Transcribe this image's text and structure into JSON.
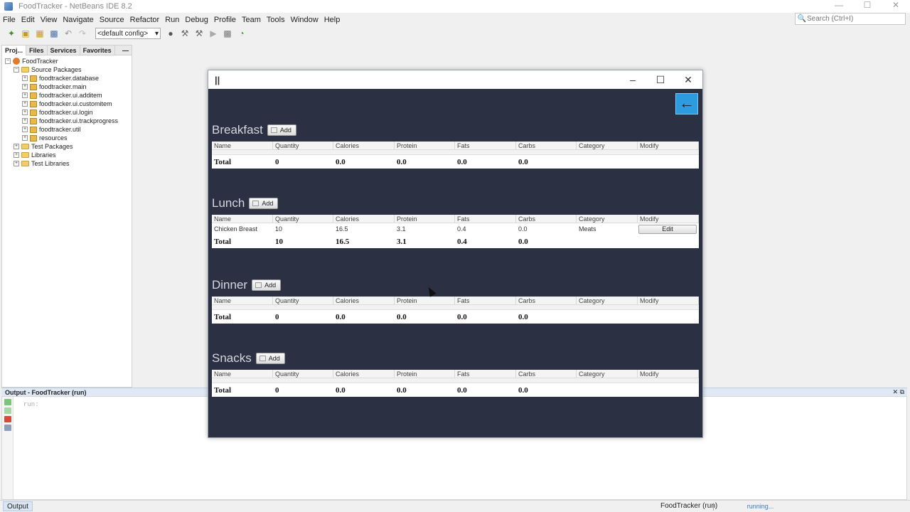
{
  "ide": {
    "title": "FoodTracker - NetBeans IDE 8.2",
    "menu": [
      "File",
      "Edit",
      "View",
      "Navigate",
      "Source",
      "Refactor",
      "Run",
      "Debug",
      "Profile",
      "Team",
      "Tools",
      "Window",
      "Help"
    ],
    "search_placeholder": "Search (Ctrl+I)",
    "config_value": "<default config>"
  },
  "project_panel": {
    "tabs": [
      "Proj...",
      "Files",
      "Services",
      "Favorites"
    ],
    "tree": {
      "root": "FoodTracker",
      "source_packages": "Source Packages",
      "packages": [
        "foodtracker.database",
        "foodtracker.main",
        "foodtracker.ui.additem",
        "foodtracker.ui.customitem",
        "foodtracker.ui.login",
        "foodtracker.ui.trackprogress",
        "foodtracker.util",
        "resources"
      ],
      "test_packages": "Test Packages",
      "libraries": "Libraries",
      "test_libraries": "Test Libraries"
    }
  },
  "output": {
    "title": "Output - FoodTracker (run)",
    "text": "run:",
    "tab_label": "Output"
  },
  "status": {
    "run_label": "FoodTracker (run)",
    "progress_text": "running..."
  },
  "app": {
    "add_label": "Add",
    "edit_label": "Edit",
    "columns": [
      "Name",
      "Quantity",
      "Calories",
      "Protein",
      "Fats",
      "Carbs",
      "Category",
      "Modify"
    ],
    "meals": {
      "breakfast": {
        "title": "Breakfast",
        "total": [
          "Total",
          "0",
          "0.0",
          "0.0",
          "0.0",
          "0.0"
        ]
      },
      "lunch": {
        "title": "Lunch",
        "item": [
          "Chicken Breast",
          "10",
          "16.5",
          "3.1",
          "0.4",
          "0.0",
          "Meats"
        ],
        "total": [
          "Total",
          "10",
          "16.5",
          "3.1",
          "0.4",
          "0.0"
        ]
      },
      "dinner": {
        "title": "Dinner",
        "total": [
          "Total",
          "0",
          "0.0",
          "0.0",
          "0.0",
          "0.0"
        ]
      },
      "snacks": {
        "title": "Snacks",
        "total": [
          "Total",
          "0",
          "0.0",
          "0.0",
          "0.0",
          "0.0"
        ]
      }
    }
  }
}
